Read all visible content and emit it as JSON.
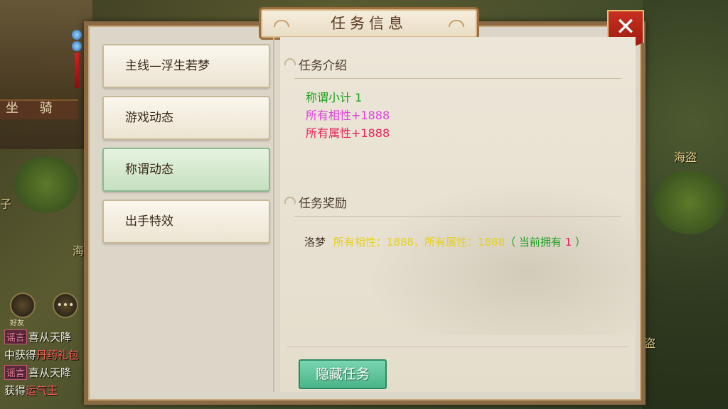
{
  "background": {
    "sign_text": "坐 骑",
    "npc_labels": [
      "海盗",
      "子",
      "海",
      "盗",
      "海盗"
    ],
    "side_button_label": "好友"
  },
  "chat": [
    {
      "tag": "谣言",
      "text": "喜从天降",
      "highlight": ""
    },
    {
      "tag": "",
      "text": "中获得",
      "highlight": "丹药礼包"
    },
    {
      "tag": "谣言",
      "text": "喜从天降",
      "highlight": ""
    },
    {
      "tag": "",
      "text": "获得",
      "highlight": "运气王"
    }
  ],
  "dialog": {
    "title": "任务信息",
    "close_label": "✕",
    "tabs": [
      {
        "label": "主线—浮生若梦",
        "active": false
      },
      {
        "label": "游戏动态",
        "active": false
      },
      {
        "label": "称谓动态",
        "active": true
      },
      {
        "label": "出手特效",
        "active": false
      }
    ],
    "intro": {
      "heading": "任务介绍",
      "lines": [
        {
          "text": "称谓小计 1",
          "color": "#1aa020"
        },
        {
          "text": "所有相性+1888",
          "color": "#e040e0"
        },
        {
          "text": "所有属性+1888",
          "color": "#e8205a"
        }
      ]
    },
    "reward": {
      "heading": "任务奖励",
      "name": "洛梦",
      "desc": "所有相性：1888，所有属性：1888",
      "owned_prefix": "（ 当前拥有 ",
      "owned_count": "1",
      "owned_suffix": " ）"
    },
    "hide_button": "隐藏任务"
  }
}
